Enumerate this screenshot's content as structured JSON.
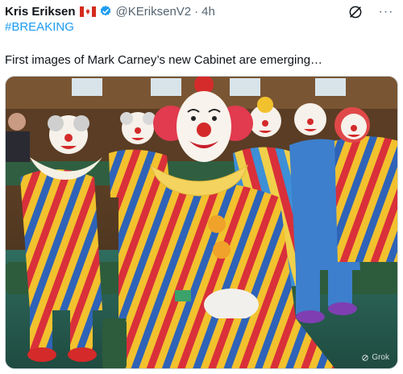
{
  "tweet": {
    "author_name": "Kris Eriksen",
    "handle": "@KEriksenV2",
    "separator": "·",
    "time": "4h",
    "hashtag": "#BREAKING",
    "text": "First images of Mark Carney’s new Cabinet are emerging…",
    "more_label": "···"
  },
  "media": {
    "watermark_label": "Grok"
  },
  "colors": {
    "link": "#1d9bf0",
    "secondary_text": "#536471",
    "verified": "#1d9bf0",
    "flag_red": "#d52b1e"
  },
  "icons": {
    "flag": "canada-flag-icon",
    "verified": "verified-badge-icon",
    "grok": "grok-icon",
    "more": "more-icon"
  }
}
